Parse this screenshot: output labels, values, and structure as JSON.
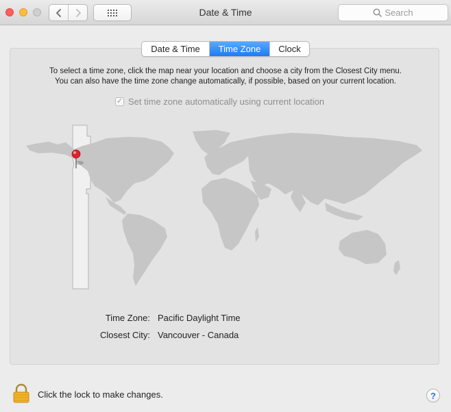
{
  "window": {
    "title": "Date & Time",
    "search_placeholder": "Search"
  },
  "toolbar": {
    "back_icon": "chevron-left-icon",
    "forward_icon": "chevron-right-icon",
    "grid_icon": "show-all-grid-icon"
  },
  "tabs": [
    {
      "label": "Date & Time",
      "active": false
    },
    {
      "label": "Time Zone",
      "active": true
    },
    {
      "label": "Clock",
      "active": false
    }
  ],
  "instructions": {
    "line1": "To select a time zone, click the map near your location and choose a city from the Closest City menu.",
    "line2": "You can also have the time zone change automatically, if possible, based on your current location."
  },
  "auto_timezone": {
    "label": "Set time zone automatically using current location",
    "checked": true,
    "enabled": false
  },
  "info": {
    "time_zone_label": "Time Zone:",
    "time_zone_value": "Pacific Daylight Time",
    "closest_city_label": "Closest City:",
    "closest_city_value": "Vancouver - Canada"
  },
  "footer": {
    "lock_text": "Click the lock to make changes.",
    "help_label": "?"
  },
  "colors": {
    "accent": "#1b7cf5",
    "map_land": "#c6c6c6",
    "selected_zone": "#f0f0f0",
    "pin": "#e0202a"
  }
}
